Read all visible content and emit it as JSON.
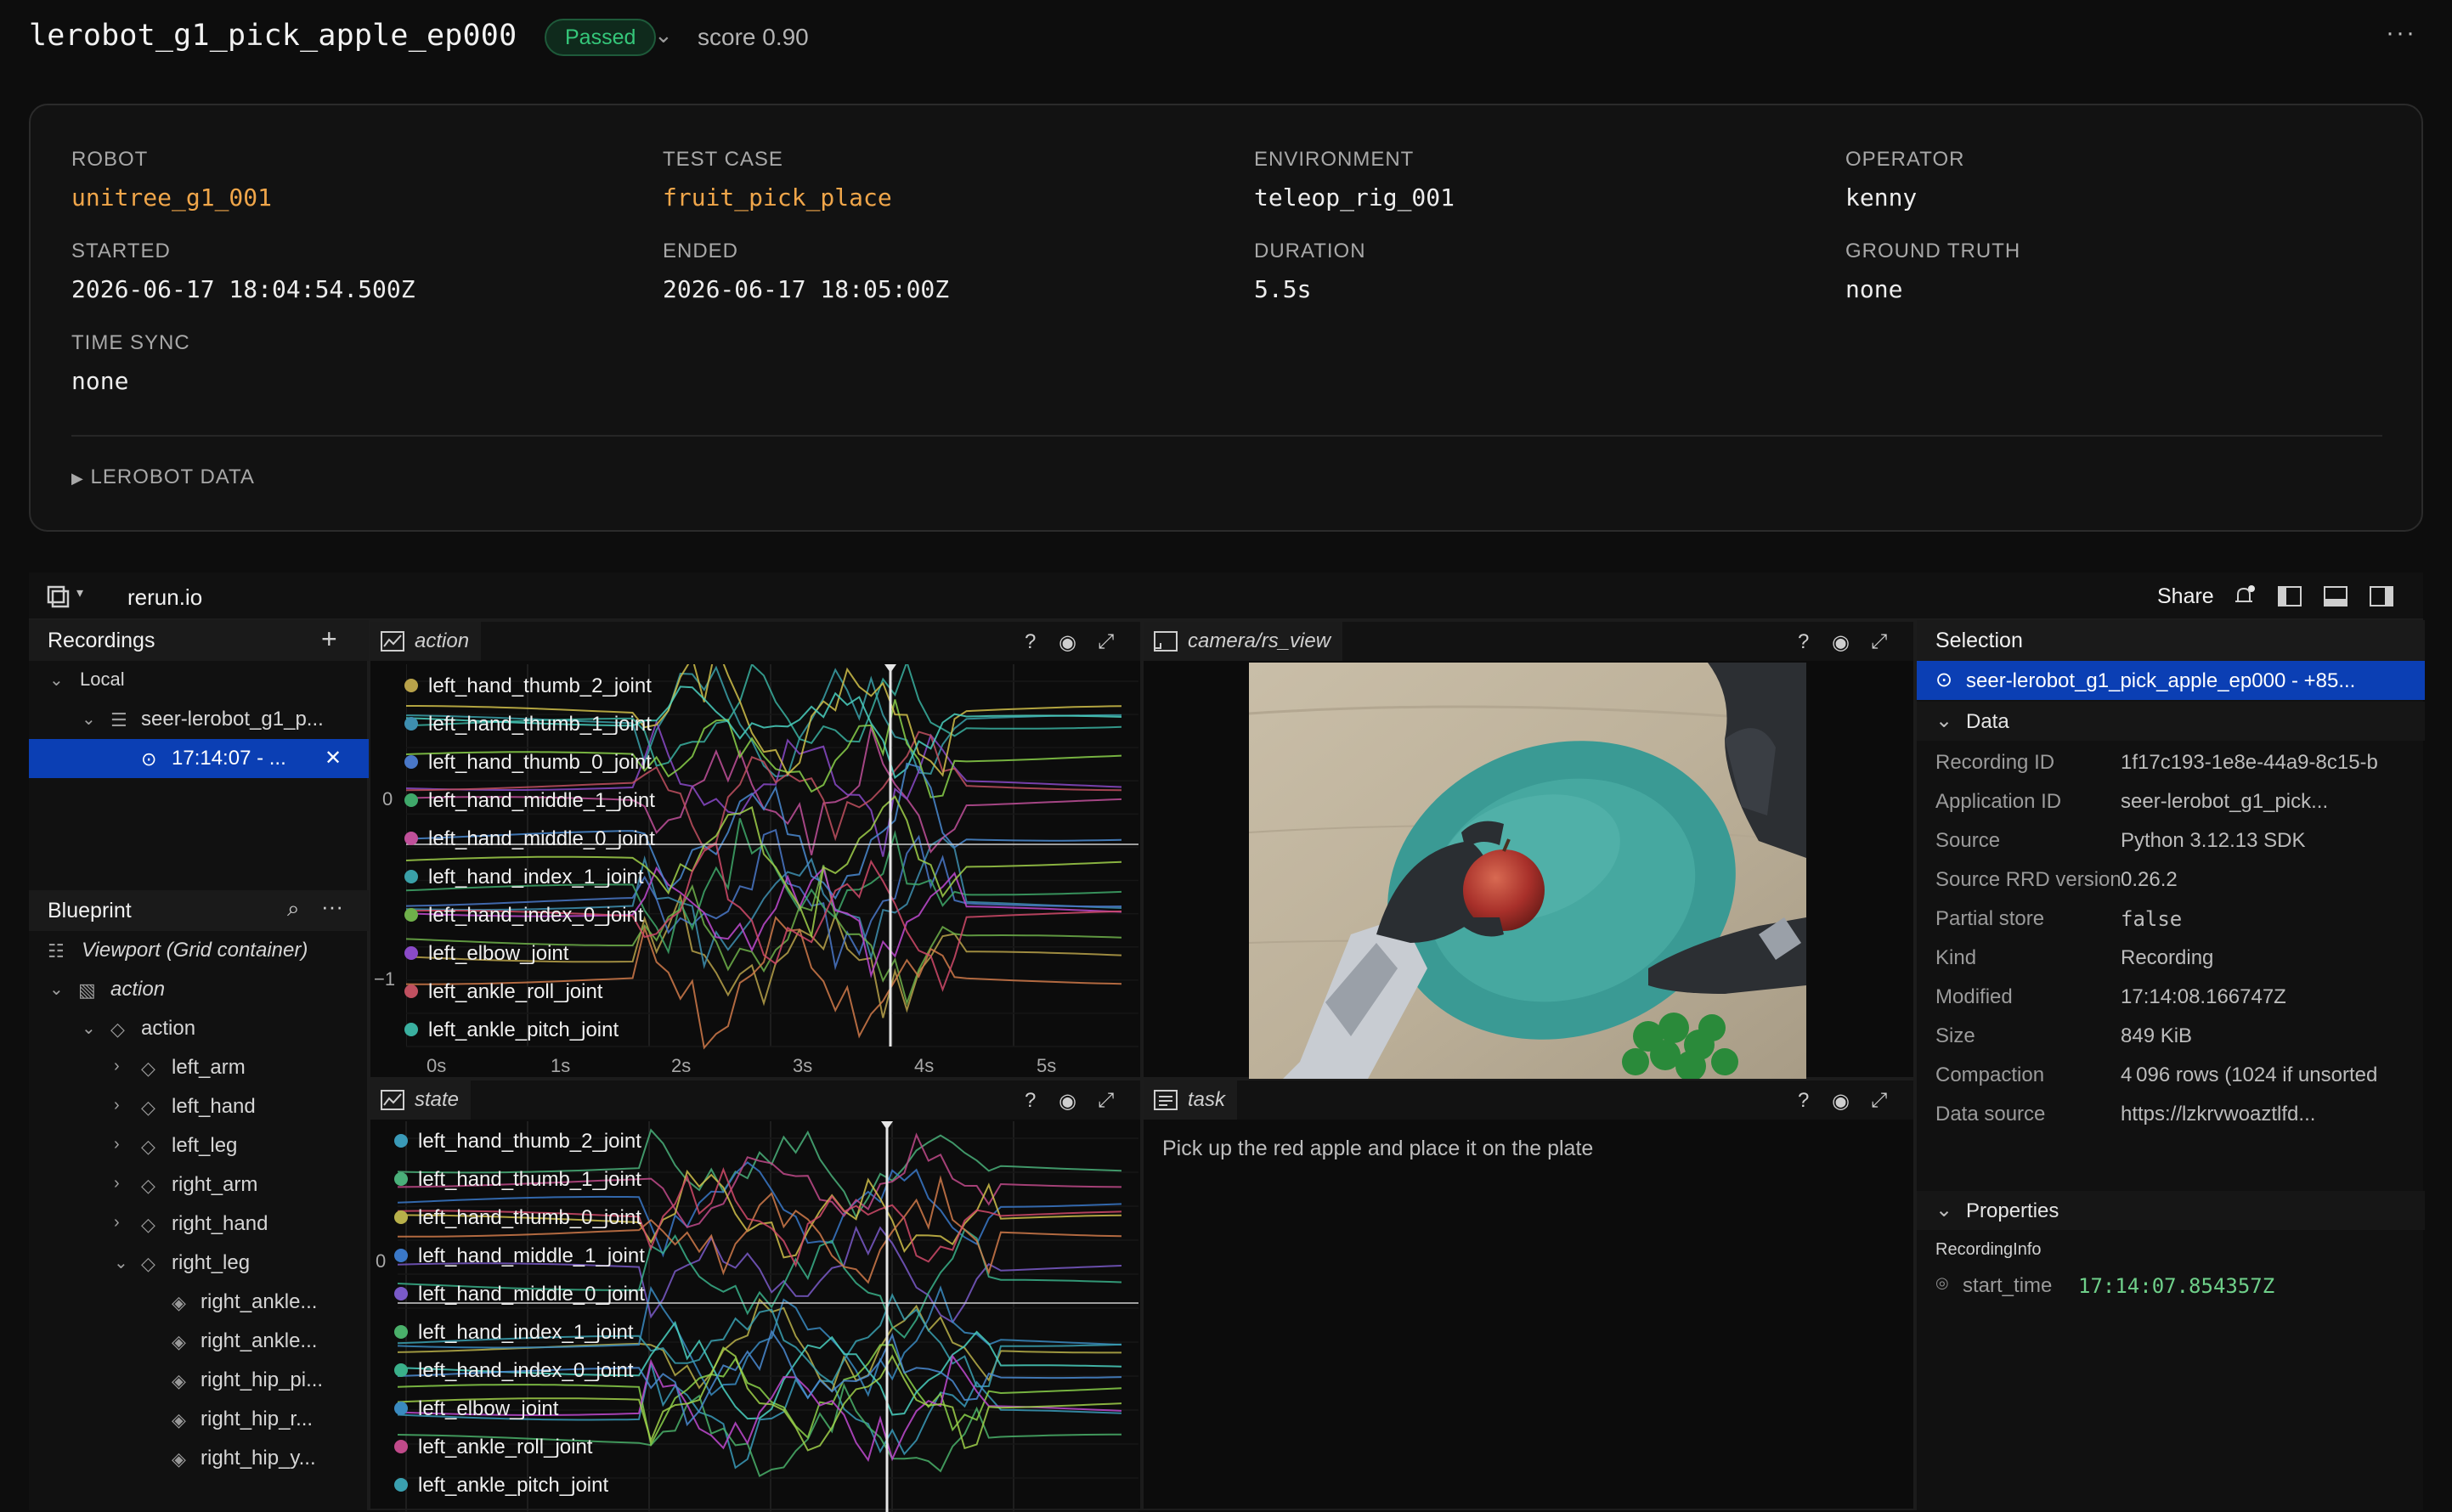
{
  "header": {
    "title": "lerobot_g1_pick_apple_ep000",
    "status": "Passed",
    "score": "score 0.90"
  },
  "meta": {
    "robot_label": "ROBOT",
    "robot": "unitree_g1_001",
    "test_case_label": "TEST CASE",
    "test_case": "fruit_pick_place",
    "environment_label": "ENVIRONMENT",
    "environment": "teleop_rig_001",
    "operator_label": "OPERATOR",
    "operator": "kenny",
    "started_label": "STARTED",
    "started": "2026-06-17 18:04:54.500Z",
    "ended_label": "ENDED",
    "ended": "2026-06-17 18:05:00Z",
    "duration_label": "DURATION",
    "duration": "5.5s",
    "ground_truth_label": "GROUND TRUTH",
    "ground_truth": "none",
    "time_sync_label": "TIME SYNC",
    "time_sync": "none",
    "lerobot_toggle": "LEROBOT DATA"
  },
  "viewer": {
    "title": "rerun.io",
    "share": "Share"
  },
  "recordings": {
    "header": "Recordings",
    "local": "Local",
    "app": "seer-lerobot_g1_p...",
    "recording": "17:14:07 - ..."
  },
  "blueprint": {
    "header": "Blueprint",
    "viewport": "Viewport (Grid container)",
    "view_action": "action",
    "entity_action": "action",
    "items": [
      "left_arm",
      "left_hand",
      "left_leg",
      "right_arm",
      "right_hand",
      "right_leg"
    ],
    "leaves": [
      "right_ankle...",
      "right_ankle...",
      "right_hip_pi...",
      "right_hip_r...",
      "right_hip_y..."
    ]
  },
  "views": {
    "action_tab": "action",
    "camera_tab": "camera/rs_view",
    "state_tab": "state",
    "task_tab": "task",
    "task_text": "Pick up the red apple and place it on the plate",
    "help": "?"
  },
  "legend_action": [
    {
      "name": "left_hand_thumb_2_joint",
      "color": "#b8a24a"
    },
    {
      "name": "left_hand_thumb_1_joint",
      "color": "#3e8fb0"
    },
    {
      "name": "left_hand_thumb_0_joint",
      "color": "#4a78c8"
    },
    {
      "name": "left_hand_middle_1_joint",
      "color": "#3fa86a"
    },
    {
      "name": "left_hand_middle_0_joint",
      "color": "#c0509a"
    },
    {
      "name": "left_hand_index_1_joint",
      "color": "#3aa0a8"
    },
    {
      "name": "left_hand_index_0_joint",
      "color": "#6fb04a"
    },
    {
      "name": "left_elbow_joint",
      "color": "#8a4ac8"
    },
    {
      "name": "left_ankle_roll_joint",
      "color": "#c05060"
    },
    {
      "name": "left_ankle_pitch_joint",
      "color": "#3ab0a0"
    }
  ],
  "legend_state": [
    {
      "name": "left_hand_thumb_2_joint",
      "color": "#3a9ab8"
    },
    {
      "name": "left_hand_thumb_1_joint",
      "color": "#4ab07a"
    },
    {
      "name": "left_hand_thumb_0_joint",
      "color": "#b8b04a"
    },
    {
      "name": "left_hand_middle_1_joint",
      "color": "#3a78c8"
    },
    {
      "name": "left_hand_middle_0_joint",
      "color": "#7a5ac8"
    },
    {
      "name": "left_hand_index_1_joint",
      "color": "#4ab06a"
    },
    {
      "name": "left_hand_index_0_joint",
      "color": "#3ab08a"
    },
    {
      "name": "left_elbow_joint",
      "color": "#3a8ac0"
    },
    {
      "name": "left_ankle_roll_joint",
      "color": "#c04a8a"
    },
    {
      "name": "left_ankle_pitch_joint",
      "color": "#3aa0b0"
    }
  ],
  "action_axis": {
    "y_ticks": [
      "0",
      "−1"
    ],
    "x_ticks": [
      "0s",
      "1s",
      "2s",
      "3s",
      "4s",
      "5s"
    ]
  },
  "state_axis": {
    "y_ticks": [
      "0"
    ]
  },
  "selection": {
    "header": "Selection",
    "selected": "seer-lerobot_g1_pick_apple_ep000 - +85...",
    "data_header": "Data",
    "rows": [
      {
        "key": "Recording ID",
        "value": "1f17c193-1e8e-44a9-8c15-b"
      },
      {
        "key": "Application ID",
        "value": "seer-lerobot_g1_pick..."
      },
      {
        "key": "Source",
        "value": "Python 3.12.13 SDK"
      },
      {
        "key": "Source RRD version",
        "value": "0.26.2"
      },
      {
        "key": "Partial store",
        "value": "false"
      },
      {
        "key": "Kind",
        "value": "Recording"
      },
      {
        "key": "Modified",
        "value": "17:14:08.166747Z"
      },
      {
        "key": "Size",
        "value": "849 KiB"
      },
      {
        "key": "Compaction",
        "value": "4 096 rows (1024 if unsorted"
      },
      {
        "key": "Data source",
        "value": "https://lzkrvwoaztlfd..."
      }
    ],
    "properties_header": "Properties",
    "recording_info": "RecordingInfo",
    "start_time_key": "start_time",
    "start_time_value": "17:14:07.854357Z"
  }
}
